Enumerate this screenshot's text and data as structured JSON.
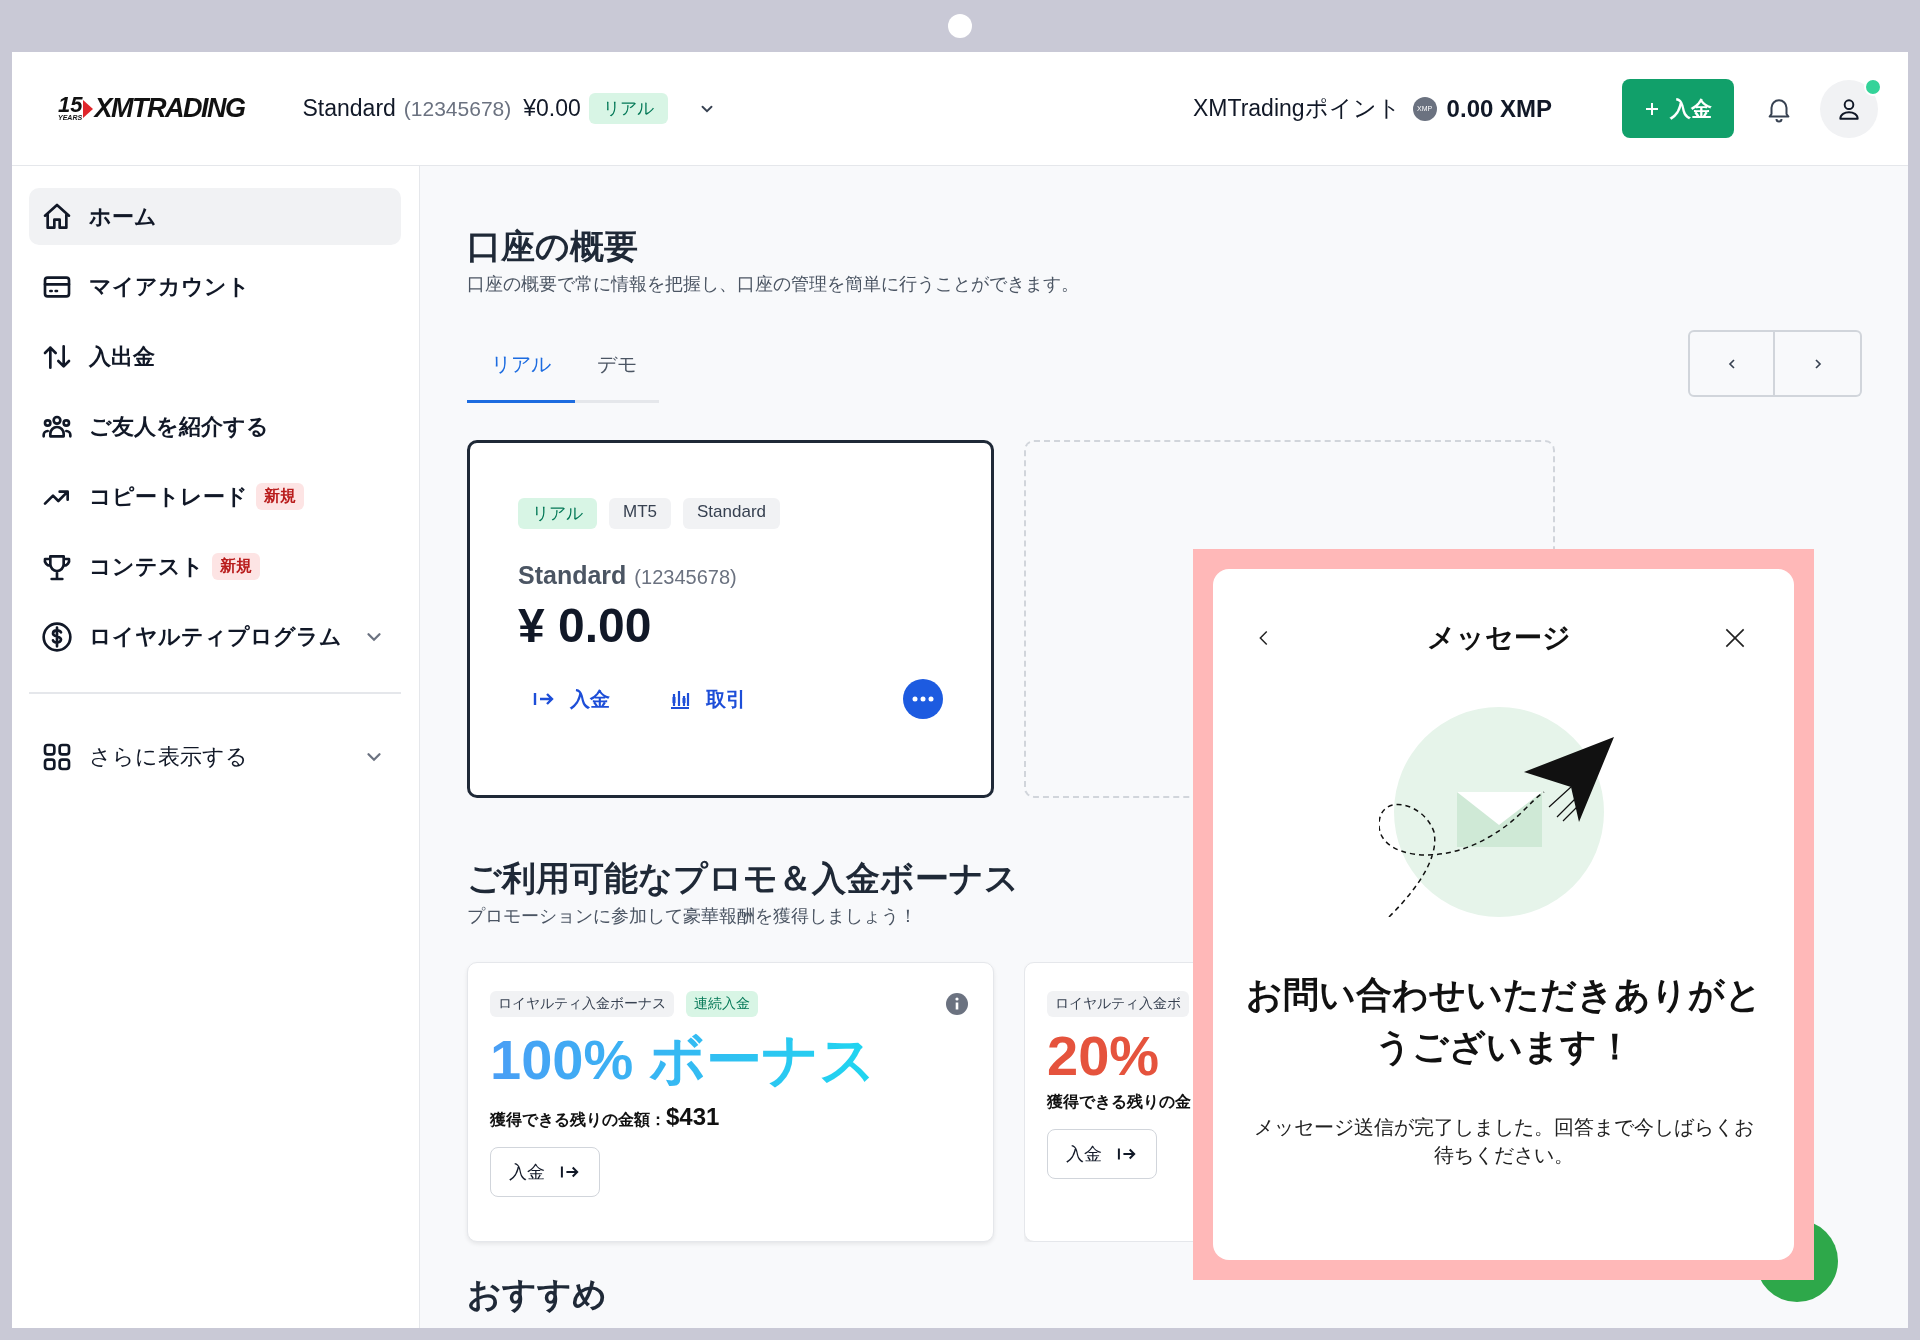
{
  "header": {
    "logo": {
      "years": "15",
      "years_label": "YEARS",
      "name": "XMTRADING"
    },
    "account": {
      "name": "Standard",
      "number": "(12345678)",
      "balance": "¥0.00",
      "badge": "リアル"
    },
    "points": {
      "label": "XMTradingポイント",
      "coin": "XMP",
      "value": "0.00 XMP"
    },
    "deposit_button": {
      "label": "入金"
    },
    "avatar": {
      "online": true
    }
  },
  "sidebar": {
    "items": [
      {
        "label": "ホーム",
        "kind": "link",
        "selected": true
      },
      {
        "label": "マイアカウント",
        "kind": "link",
        "selected": false
      },
      {
        "label": "入出金",
        "kind": "link",
        "selected": false
      },
      {
        "label": "ご友人を紹介する",
        "kind": "link",
        "selected": false
      },
      {
        "label": "コピートレード",
        "kind": "link",
        "selected": false,
        "badge": "新規"
      },
      {
        "label": "コンテスト",
        "kind": "link",
        "selected": false,
        "badge": "新規"
      },
      {
        "label": "ロイヤルティプログラム",
        "kind": "group",
        "selected": false,
        "expanded": false
      }
    ],
    "more": {
      "label": "さらに表示する",
      "expanded": false
    }
  },
  "overview": {
    "title": "口座の概要",
    "subtitle": "口座の概要で常に情報を把握し、口座の管理を簡単に行うことができます。",
    "tabs": [
      {
        "label": "リアル",
        "selected": true
      },
      {
        "label": "デモ",
        "selected": false
      }
    ],
    "account_card": {
      "tags": [
        {
          "text": "リアル",
          "kind": "status"
        },
        {
          "text": "MT5",
          "kind": "plain"
        },
        {
          "text": "Standard",
          "kind": "plain"
        }
      ],
      "name": "Standard",
      "number": "(12345678)",
      "balance": "¥ 0.00",
      "actions": [
        {
          "label": "入金"
        },
        {
          "label": "取引"
        }
      ]
    }
  },
  "promos": {
    "title": "ご利用可能なプロモ＆入金ボーナス",
    "subtitle": "プロモーションに参加して豪華報酬を獲得しましょう！",
    "cards": [
      {
        "tags": [
          {
            "text": "ロイヤルティ入金ボーナス",
            "kind": "plain"
          },
          {
            "text": "連続入金",
            "kind": "status"
          }
        ],
        "headline": "100% ボーナス",
        "kind": "gradient",
        "remaining_label": "獲得できる残りの金額：",
        "remaining_value": "$431",
        "button": "入金",
        "info": true
      },
      {
        "tags": [
          {
            "text": "ロイヤルティ入金ボ",
            "kind": "plain"
          }
        ],
        "headline": "20%",
        "kind": "red",
        "remaining_label": "獲得できる残りの金",
        "button": "入金"
      }
    ]
  },
  "recommended": {
    "title": "おすすめ"
  },
  "message_dialog": {
    "title": "メッセージ",
    "heading": "お問い合わせいただきありがとうございます！",
    "body": "メッセージ送信が完了しました。回答まで今しばらくお待ちください。"
  }
}
